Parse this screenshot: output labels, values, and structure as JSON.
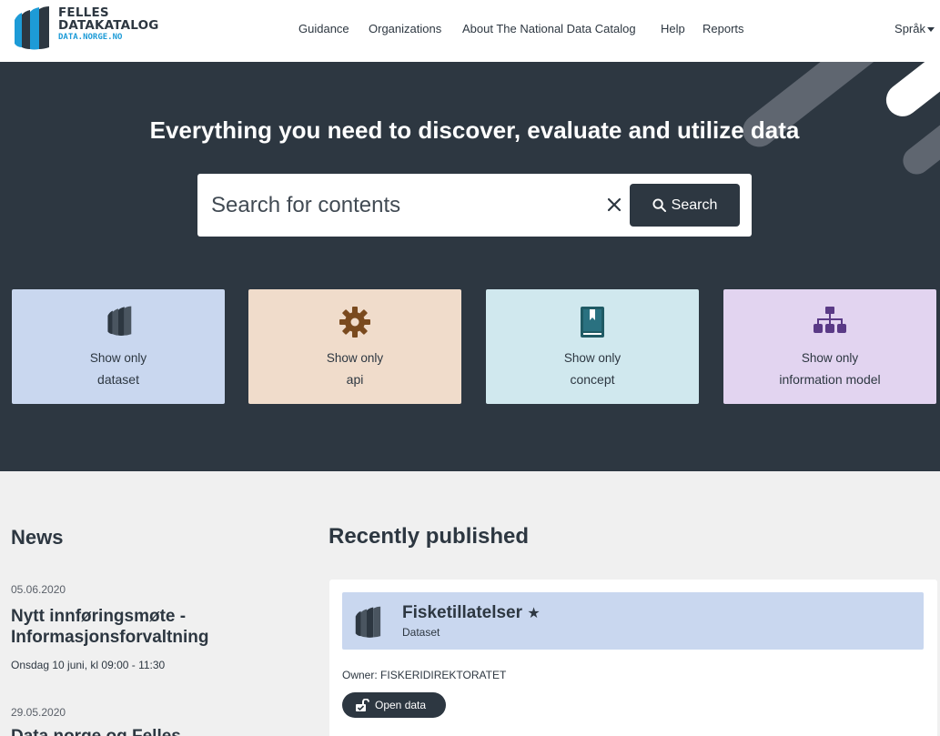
{
  "header": {
    "logo_line1": "FELLES",
    "logo_line2": "DATAKATALOG",
    "logo_line3": "DATA.NORGE.NO",
    "nav": [
      "Guidance",
      "Organizations",
      "About The National Data Catalog",
      "Help",
      "Reports"
    ],
    "language_label": "Språk"
  },
  "hero": {
    "title": "Everything you need to discover, evaluate and utilize data",
    "search": {
      "placeholder": "Search for contents",
      "value": "",
      "button_label": "Search"
    },
    "filters": [
      {
        "sub": "Show only",
        "main": "dataset",
        "color": "#c9d7ef",
        "icon": "dataset-icon"
      },
      {
        "sub": "Show only",
        "main": "api",
        "color": "#f0dccb",
        "icon": "gear-icon"
      },
      {
        "sub": "Show only",
        "main": "concept",
        "color": "#d0e8ee",
        "icon": "book-icon"
      },
      {
        "sub": "Show only",
        "main": "information model",
        "color": "#e2d4f0",
        "icon": "hierarchy-icon"
      }
    ]
  },
  "news": {
    "heading": "News",
    "items": [
      {
        "date": "05.06.2020",
        "title": "Nytt innføringsmøte - Informasjonsforvaltning",
        "sub": "Onsdag 10 juni, kl 09:00 - 11:30"
      },
      {
        "date": "29.05.2020",
        "title": "Data.norge og Felles"
      }
    ]
  },
  "recent": {
    "heading": "Recently published",
    "card": {
      "title": "Fisketillatelser",
      "type": "Dataset",
      "owner_label": "Owner:",
      "owner": "FISKERIDIREKTORATET",
      "badge": "Open data"
    }
  },
  "colors": {
    "dark": "#2d3741",
    "accent": "#1d9bd7",
    "bg": "#f0f0f0"
  }
}
